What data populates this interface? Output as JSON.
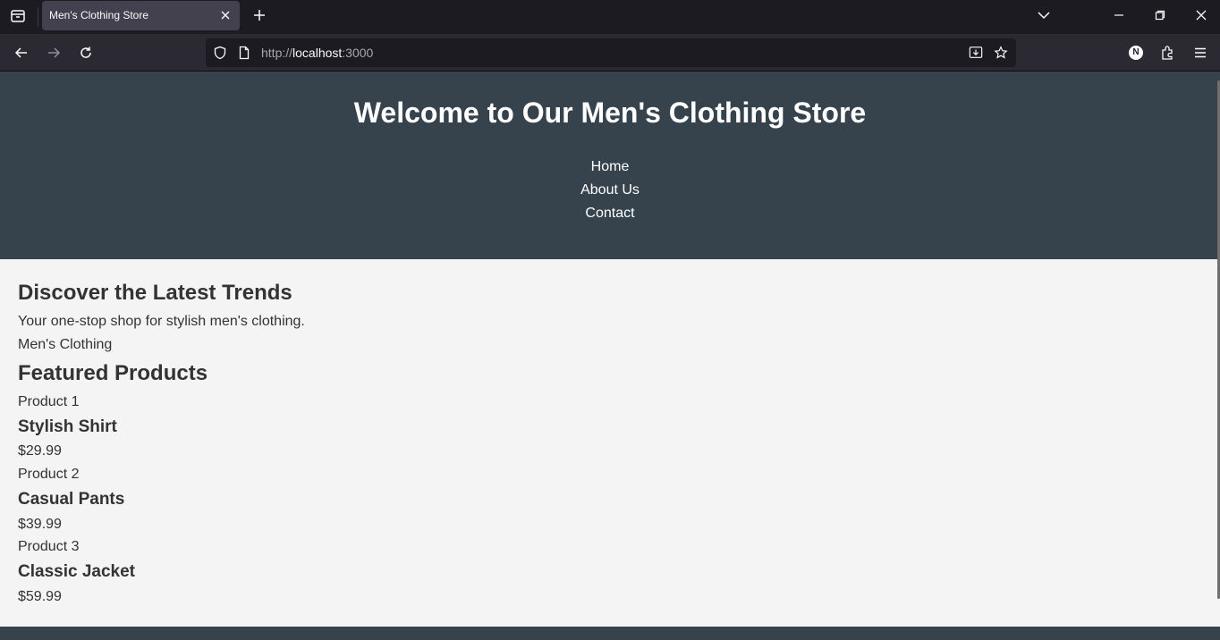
{
  "browser": {
    "tab_title": "Men's Clothing Store",
    "url_prefix": "http://",
    "url_host": "localhost",
    "url_port": ":3000",
    "profile_initial": "N"
  },
  "site": {
    "title": "Welcome to Our Men's Clothing Store",
    "nav": [
      "Home",
      "About Us",
      "Contact"
    ]
  },
  "hero": {
    "heading": "Discover the Latest Trends",
    "tagline": "Your one-stop shop for stylish men's clothing.",
    "category": "Men's Clothing"
  },
  "featured": {
    "heading": "Featured Products",
    "products": [
      {
        "label": "Product 1",
        "name": "Stylish Shirt",
        "price": "$29.99"
      },
      {
        "label": "Product 2",
        "name": "Casual Pants",
        "price": "$39.99"
      },
      {
        "label": "Product 3",
        "name": "Classic Jacket",
        "price": "$59.99"
      }
    ]
  }
}
